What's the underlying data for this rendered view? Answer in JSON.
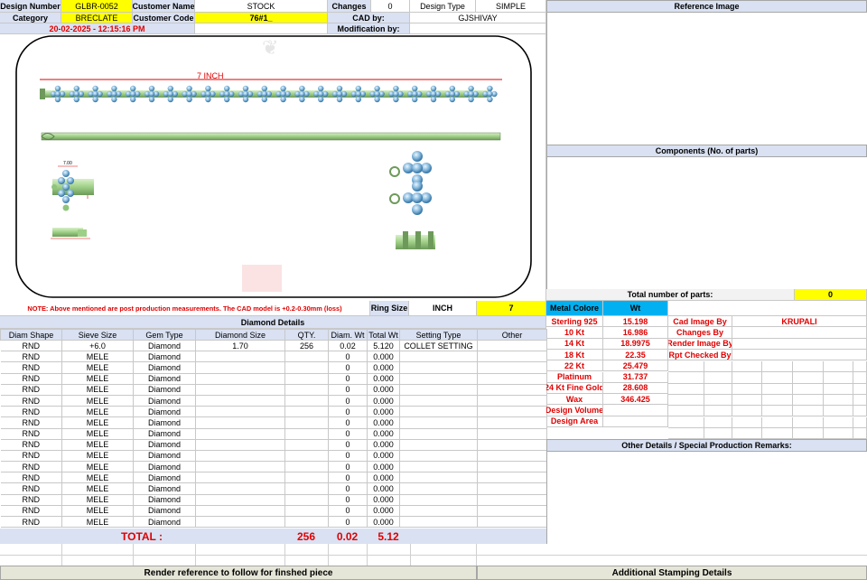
{
  "header": {
    "design_number_label": "Design Number",
    "design_number": "GLBR-0052",
    "customer_name_label": "Customer Name",
    "customer_name": "STOCK",
    "changes_label": "Changes",
    "changes": "0",
    "design_type_label": "Design Type",
    "design_type": "SIMPLE",
    "category_label": "Category",
    "category": "BRECLATE",
    "customer_code_label": "Customer Code",
    "customer_code": "76#1_",
    "cad_by_label": "CAD by:",
    "cad_by": "GJSHIVAY",
    "date": "20-02-2025 - 12:15:16 PM",
    "modification_label": "Modification by:"
  },
  "drawing": {
    "length_label": "7 INCH",
    "dim_width": "7.00",
    "dim_height": "5.00"
  },
  "note": {
    "text": "NOTE: Above mentioned are post production measurements. The CAD model is +0.2-0.30mm (loss)",
    "ring_size_label": "Ring Size",
    "unit": "INCH",
    "size": "7"
  },
  "right_panel": {
    "reference_image": "Reference Image",
    "components": "Components (No. of parts)",
    "total_parts_label": "Total number of parts:",
    "total_parts": "0",
    "other_details": "Other Details / Special Production Remarks:"
  },
  "metal": {
    "colore_label": "Metal Colore",
    "wt_label": "Wt",
    "rows": [
      {
        "name": "Sterling 925",
        "wt": "15.198"
      },
      {
        "name": "10 Kt",
        "wt": "16.986"
      },
      {
        "name": "14 Kt",
        "wt": "18.9975"
      },
      {
        "name": "18 Kt",
        "wt": "22.35"
      },
      {
        "name": "22 Kt",
        "wt": "25.479"
      },
      {
        "name": "Platinum",
        "wt": "31.737"
      },
      {
        "name": "24 Kt Fine Gold",
        "wt": "28.608"
      },
      {
        "name": "Wax",
        "wt": "346.425"
      },
      {
        "name": "Design Volume",
        "wt": ""
      },
      {
        "name": "Design Area",
        "wt": ""
      }
    ],
    "roles": [
      {
        "label": "Cad Image By",
        "value": "KRUPALI"
      },
      {
        "label": "Changes By",
        "value": ""
      },
      {
        "label": "Render Image By",
        "value": ""
      },
      {
        "label": "Rpt Checked By",
        "value": ""
      }
    ]
  },
  "diamond": {
    "title": "Diamond Details",
    "columns": [
      "Diam Shape",
      "Sieve Size",
      "Gem Type",
      "Diamond Size",
      "QTY.",
      "Diam. Wt",
      "Total Wt",
      "Setting Type",
      "Other"
    ],
    "rows": [
      [
        "RND",
        "+6.0",
        "Diamond",
        "1.70",
        "256",
        "0.02",
        "5.120",
        "COLLET SETTING",
        ""
      ],
      [
        "RND",
        "MELE",
        "Diamond",
        "",
        "",
        "0",
        "0.000",
        "",
        ""
      ],
      [
        "RND",
        "MELE",
        "Diamond",
        "",
        "",
        "0",
        "0.000",
        "",
        ""
      ],
      [
        "RND",
        "MELE",
        "Diamond",
        "",
        "",
        "0",
        "0.000",
        "",
        ""
      ],
      [
        "RND",
        "MELE",
        "Diamond",
        "",
        "",
        "0",
        "0.000",
        "",
        ""
      ],
      [
        "RND",
        "MELE",
        "Diamond",
        "",
        "",
        "0",
        "0.000",
        "",
        ""
      ],
      [
        "RND",
        "MELE",
        "Diamond",
        "",
        "",
        "0",
        "0.000",
        "",
        ""
      ],
      [
        "RND",
        "MELE",
        "Diamond",
        "",
        "",
        "0",
        "0.000",
        "",
        ""
      ],
      [
        "RND",
        "MELE",
        "Diamond",
        "",
        "",
        "0",
        "0.000",
        "",
        ""
      ],
      [
        "RND",
        "MELE",
        "Diamond",
        "",
        "",
        "0",
        "0.000",
        "",
        ""
      ],
      [
        "RND",
        "MELE",
        "Diamond",
        "",
        "",
        "0",
        "0.000",
        "",
        ""
      ],
      [
        "RND",
        "MELE",
        "Diamond",
        "",
        "",
        "0",
        "0.000",
        "",
        ""
      ],
      [
        "RND",
        "MELE",
        "Diamond",
        "",
        "",
        "0",
        "0.000",
        "",
        ""
      ],
      [
        "RND",
        "MELE",
        "Diamond",
        "",
        "",
        "0",
        "0.000",
        "",
        ""
      ],
      [
        "RND",
        "MELE",
        "Diamond",
        "",
        "",
        "0",
        "0.000",
        "",
        ""
      ],
      [
        "RND",
        "MELE",
        "Diamond",
        "",
        "",
        "0",
        "0.000",
        "",
        ""
      ],
      [
        "RND",
        "MELE",
        "Diamond",
        "",
        "",
        "0",
        "0.000",
        "",
        ""
      ]
    ],
    "total_label": "TOTAL :",
    "total_qty": "256",
    "total_diam_wt": "0.02",
    "total_wt": "5.12"
  },
  "footer": {
    "render_label": "Render reference to follow for finshed piece",
    "stamping_label": "Additional Stamping Details"
  },
  "colors": {
    "label_bg": "#d9e1f2",
    "highlight": "#ffff00",
    "accent_blue": "#00b0f0",
    "red_text": "#e00000"
  }
}
